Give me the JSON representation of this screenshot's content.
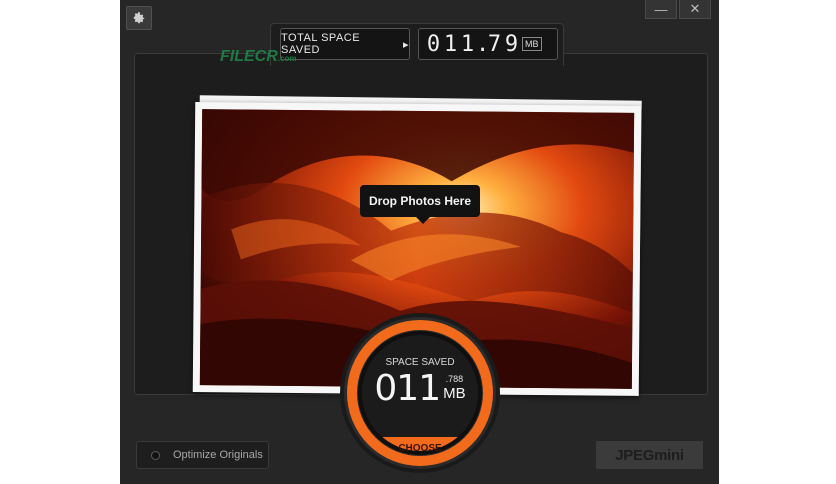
{
  "window": {
    "settings_icon": "gear-icon",
    "minimize_label": "—",
    "close_label": "✕"
  },
  "total": {
    "label": "TOTAL SPACE SAVED",
    "arrow": "▸",
    "digits": [
      "0",
      "1",
      "1",
      ".",
      "7",
      "9"
    ],
    "unit": "MB"
  },
  "watermark": {
    "text": "FILECR",
    "suffix": ".com"
  },
  "dropzone": {
    "tooltip": "Drop Photos Here"
  },
  "gauge": {
    "title": "SPACE SAVED",
    "value_main": "011",
    "value_fraction": ".788",
    "unit": "MB",
    "button_label": "CHOOSE"
  },
  "footer": {
    "optimize_label": "Optimize Originals",
    "brand": "JPEGmini"
  },
  "colors": {
    "accent_orange": "#f26a1b",
    "background": "#262626",
    "panel": "#1d1d1d"
  }
}
